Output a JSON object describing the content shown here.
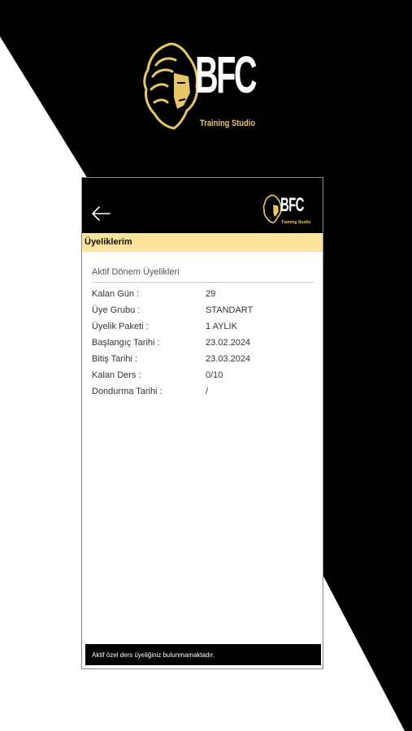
{
  "brand": {
    "name": "BFC",
    "tagline": "Training Studio",
    "logo_icon": "lion-head-icon",
    "accent_color": "#e6c766"
  },
  "app": {
    "back_icon": "arrow-left-icon",
    "page_title": "Üyeliklerim",
    "title_bar_color": "#fbe49a",
    "section_title": "Aktif Dönem Üyelikleri",
    "rows": [
      {
        "label": "Kalan Gün :",
        "value": "29"
      },
      {
        "label": "Üye Grubu :",
        "value": "STANDART"
      },
      {
        "label": "Üyelik Paketi :",
        "value": "1 AYLIK"
      },
      {
        "label": "Başlangıç Tarihi :",
        "value": "23.02.2024"
      },
      {
        "label": "Bitiş Tarihi :",
        "value": "23.03.2024"
      },
      {
        "label": "Kalan Ders :",
        "value": "0/10"
      },
      {
        "label": "Dondurma Tarihi :",
        "value": "/"
      }
    ],
    "footer_message": "Aktif özel ders üyeliğiniz bulunmamaktadır."
  }
}
